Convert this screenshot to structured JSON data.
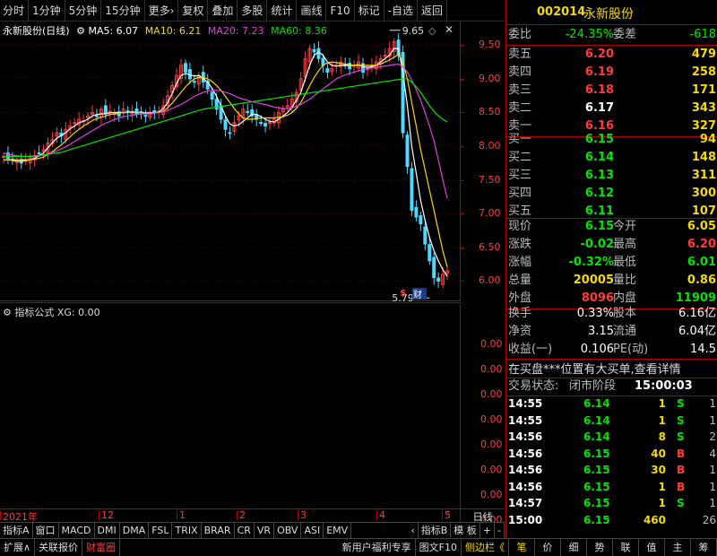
{
  "toolbar": {
    "tabs": [
      "分时",
      "1分钟",
      "5分钟",
      "15分钟",
      "更多›",
      "复权",
      "叠加",
      "多股",
      "统计",
      "画线",
      "F10",
      "标记",
      "-自选",
      "返回"
    ]
  },
  "chart": {
    "stock_name": "永新股份(日线)",
    "ma5": "MA5: 6.07",
    "ma10": "MA10: 6.21",
    "ma20": "MA20: 7.23",
    "ma60": "MA60: 8.36",
    "high_label": "9.65",
    "low_label": "5.79",
    "price_ticks": [
      "9.50",
      "9.00",
      "8.50",
      "8.00",
      "7.50",
      "7.00",
      "6.50",
      "6.00"
    ],
    "sub_title": "指标公式",
    "sub_value": "XG: 0.00",
    "sub_ticks": [
      "0.00",
      "0.00",
      "0.00",
      "0.00",
      "0.00",
      "0.00",
      "0.00",
      "0.00"
    ],
    "time_labels": [
      "2021年",
      "12",
      "1",
      "2",
      "3",
      "4",
      "5"
    ],
    "day_btn": "日线",
    "marker_s": "$",
    "marker_cai": "财",
    "colors": {
      "ma5": "#ffffff",
      "ma10": "#f5d90a",
      "ma20": "#e040e0",
      "ma60": "#00e600",
      "up": "#ff3b3b",
      "down": "#4fd8ff"
    }
  },
  "chart_data": {
    "type": "line",
    "title": "永新股份(日线)",
    "xlabel": "",
    "ylabel": "",
    "ylim": [
      5.7,
      9.85
    ],
    "x": [
      1,
      2,
      3,
      4,
      5,
      6,
      7,
      8,
      9,
      10,
      11,
      12,
      13,
      14,
      15,
      16,
      17,
      18,
      19,
      20,
      21,
      22,
      23,
      24,
      25,
      26,
      27,
      28,
      29,
      30,
      31,
      32,
      33,
      34,
      35,
      36,
      37,
      38,
      39,
      40,
      41,
      42,
      43,
      44,
      45,
      46,
      47,
      48,
      49,
      50,
      51,
      52,
      53,
      54,
      55,
      56,
      57,
      58,
      59,
      60,
      61,
      62,
      63,
      64,
      65,
      66,
      67,
      68,
      69,
      70,
      71,
      72,
      73,
      74,
      75,
      76,
      77,
      78,
      79,
      80,
      81,
      82,
      83,
      84,
      85,
      86,
      87,
      88,
      89,
      90,
      91,
      92,
      93,
      94,
      95,
      96,
      97,
      98,
      99,
      100,
      101,
      102,
      103,
      104,
      105,
      106,
      107,
      108,
      109,
      110,
      111,
      112,
      113,
      114,
      115,
      116,
      117,
      118,
      119,
      120
    ],
    "candles_close": [
      7.85,
      7.82,
      7.8,
      7.78,
      7.75,
      7.79,
      7.83,
      7.86,
      7.9,
      7.95,
      8.05,
      8.1,
      8.2,
      8.15,
      8.25,
      8.3,
      8.35,
      8.4,
      8.38,
      8.45,
      8.5,
      8.45,
      8.55,
      8.48,
      8.52,
      8.5,
      8.45,
      8.55,
      8.5,
      8.52,
      8.48,
      8.5,
      8.45,
      8.48,
      8.5,
      8.52,
      8.6,
      8.75,
      8.9,
      9.05,
      9.2,
      9.1,
      9.0,
      8.95,
      9.05,
      8.95,
      8.85,
      8.7,
      8.55,
      8.4,
      8.25,
      8.2,
      8.35,
      8.45,
      8.55,
      8.5,
      8.45,
      8.4,
      8.35,
      8.3,
      8.35,
      8.4,
      8.5,
      8.55,
      8.6,
      8.7,
      8.8,
      9.0,
      9.3,
      9.45,
      9.4,
      9.3,
      9.2,
      9.1,
      9.15,
      9.2,
      9.25,
      9.2,
      9.15,
      9.2,
      9.25,
      9.1,
      9.15,
      9.2,
      9.25,
      9.3,
      9.35,
      9.45,
      9.55,
      9.35,
      8.2,
      7.7,
      7.05,
      6.95,
      6.85,
      6.55,
      6.3,
      6.05,
      6.0,
      6.1,
      6.15
    ],
    "series": [
      {
        "name": "MA5",
        "values": [
          7.8,
          7.8,
          7.79,
          7.78,
          7.78,
          7.79,
          7.8,
          7.82,
          7.86,
          7.9,
          7.98,
          8.05,
          8.12,
          8.16,
          8.2,
          8.26,
          8.3,
          8.35,
          8.37,
          8.4,
          8.45,
          8.47,
          8.48,
          8.48,
          8.5,
          8.5,
          8.5,
          8.5,
          8.5,
          8.51,
          8.5,
          8.5,
          8.49,
          8.48,
          8.49,
          8.51,
          8.56,
          8.65,
          8.78,
          8.93,
          9.05,
          9.08,
          9.06,
          9.04,
          9.05,
          9.0,
          8.95,
          8.86,
          8.74,
          8.6,
          8.45,
          8.33,
          8.3,
          8.32,
          8.37,
          8.42,
          8.48,
          8.47,
          8.44,
          8.4,
          8.37,
          8.36,
          8.4,
          8.45,
          8.5,
          8.58,
          8.68,
          8.8,
          9.0,
          9.2,
          9.35,
          9.4,
          9.35,
          9.25,
          9.2,
          9.19,
          9.2,
          9.2,
          9.2,
          9.2,
          9.21,
          9.18,
          9.17,
          9.18,
          9.2,
          9.25,
          9.3,
          9.35,
          9.45,
          9.45,
          9.1,
          8.6,
          8.0,
          7.6,
          7.2,
          6.9,
          6.65,
          6.45,
          6.3,
          6.17,
          6.07
        ]
      },
      {
        "name": "MA10",
        "values": [
          7.8,
          7.8,
          7.8,
          7.8,
          7.8,
          7.8,
          7.8,
          7.81,
          7.82,
          7.84,
          7.88,
          7.92,
          7.97,
          8.02,
          8.08,
          8.14,
          8.2,
          8.25,
          8.3,
          8.34,
          8.38,
          8.41,
          8.43,
          8.45,
          8.47,
          8.48,
          8.49,
          8.5,
          8.5,
          8.5,
          8.5,
          8.5,
          8.5,
          8.5,
          8.5,
          8.5,
          8.52,
          8.57,
          8.64,
          8.72,
          8.8,
          8.88,
          8.95,
          9.0,
          9.02,
          9.02,
          9.0,
          8.96,
          8.9,
          8.83,
          8.74,
          8.65,
          8.56,
          8.48,
          8.42,
          8.4,
          8.4,
          8.41,
          8.42,
          8.42,
          8.42,
          8.42,
          8.43,
          8.44,
          8.46,
          8.5,
          8.56,
          8.65,
          8.77,
          8.9,
          9.02,
          9.12,
          9.2,
          9.24,
          9.25,
          9.24,
          9.23,
          9.22,
          9.21,
          9.2,
          9.2,
          9.2,
          9.2,
          9.2,
          9.2,
          9.22,
          9.25,
          9.28,
          9.32,
          9.36,
          9.25,
          9.0,
          8.65,
          8.3,
          7.95,
          7.65,
          7.35,
          7.05,
          6.75,
          6.45,
          6.21
        ]
      },
      {
        "name": "MA20",
        "values": [
          7.9,
          7.88,
          7.87,
          7.86,
          7.85,
          7.85,
          7.85,
          7.85,
          7.86,
          7.87,
          7.89,
          7.91,
          7.93,
          7.96,
          7.99,
          8.03,
          8.07,
          8.11,
          8.15,
          8.19,
          8.23,
          8.27,
          8.31,
          8.34,
          8.37,
          8.4,
          8.42,
          8.44,
          8.45,
          8.46,
          8.47,
          8.48,
          8.48,
          8.48,
          8.49,
          8.5,
          8.51,
          8.53,
          8.56,
          8.59,
          8.62,
          8.66,
          8.7,
          8.74,
          8.77,
          8.8,
          8.82,
          8.83,
          8.83,
          8.82,
          8.8,
          8.78,
          8.75,
          8.72,
          8.7,
          8.68,
          8.66,
          8.65,
          8.63,
          8.62,
          8.6,
          8.58,
          8.57,
          8.56,
          8.56,
          8.57,
          8.59,
          8.62,
          8.66,
          8.7,
          8.75,
          8.8,
          8.85,
          8.9,
          8.95,
          9.0,
          9.03,
          9.06,
          9.08,
          9.1,
          9.12,
          9.14,
          9.15,
          9.16,
          9.17,
          9.18,
          9.19,
          9.2,
          9.21,
          9.22,
          9.18,
          9.1,
          8.98,
          8.84,
          8.68,
          8.5,
          8.3,
          8.08,
          7.8,
          7.5,
          7.23
        ]
      },
      {
        "name": "MA60",
        "values": [
          7.85,
          7.85,
          7.85,
          7.85,
          7.85,
          7.85,
          7.85,
          7.86,
          7.86,
          7.87,
          7.88,
          7.89,
          7.9,
          7.91,
          7.93,
          7.95,
          7.97,
          7.99,
          8.01,
          8.03,
          8.05,
          8.07,
          8.09,
          8.11,
          8.13,
          8.15,
          8.17,
          8.19,
          8.21,
          8.23,
          8.25,
          8.27,
          8.29,
          8.31,
          8.33,
          8.35,
          8.37,
          8.39,
          8.41,
          8.43,
          8.45,
          8.47,
          8.49,
          8.51,
          8.53,
          8.55,
          8.56,
          8.57,
          8.58,
          8.59,
          8.6,
          8.61,
          8.62,
          8.63,
          8.64,
          8.65,
          8.66,
          8.67,
          8.68,
          8.69,
          8.7,
          8.71,
          8.72,
          8.73,
          8.74,
          8.75,
          8.76,
          8.77,
          8.78,
          8.79,
          8.8,
          8.81,
          8.82,
          8.83,
          8.84,
          8.85,
          8.86,
          8.87,
          8.88,
          8.89,
          8.9,
          8.91,
          8.92,
          8.93,
          8.94,
          8.95,
          8.96,
          8.97,
          8.98,
          8.99,
          9.0,
          9.0,
          8.95,
          8.88,
          8.8,
          8.7,
          8.6,
          8.52,
          8.45,
          8.4,
          8.36
        ]
      }
    ]
  },
  "quote": {
    "code": "002014",
    "name": "永新股份",
    "weibi_label": "委比",
    "weibi": "-24.35%",
    "weicha_label": "委差",
    "weicha": "-618",
    "sell": [
      {
        "label": "卖五",
        "price": "6.20",
        "vol": "479"
      },
      {
        "label": "卖四",
        "price": "6.19",
        "vol": "258"
      },
      {
        "label": "卖三",
        "price": "6.18",
        "vol": "171"
      },
      {
        "label": "卖二",
        "price": "6.17",
        "vol": "343"
      },
      {
        "label": "卖一",
        "price": "6.16",
        "vol": "327"
      }
    ],
    "buy": [
      {
        "label": "买一",
        "price": "6.15",
        "vol": "94"
      },
      {
        "label": "买二",
        "price": "6.14",
        "vol": "148"
      },
      {
        "label": "买三",
        "price": "6.13",
        "vol": "311"
      },
      {
        "label": "买四",
        "price": "6.12",
        "vol": "300"
      },
      {
        "label": "买五",
        "price": "6.11",
        "vol": "107"
      }
    ],
    "stats": [
      {
        "l1": "现价",
        "v1": "6.15",
        "l2": "今开",
        "v2": "6.05"
      },
      {
        "l1": "涨跌",
        "v1": "-0.02",
        "l2": "最高",
        "v2": "6.20"
      },
      {
        "l1": "涨幅",
        "v1": "-0.32%",
        "l2": "最低",
        "v2": "6.01"
      },
      {
        "l1": "总量",
        "v1": "20005",
        "l2": "量比",
        "v2": "0.86"
      },
      {
        "l1": "外盘",
        "v1": "8096",
        "l2": "内盘",
        "v2": "11909"
      }
    ],
    "stats2": [
      {
        "l1": "换手",
        "v1": "0.33%",
        "l2": "股本",
        "v2": "6.16亿"
      },
      {
        "l1": "净资",
        "v1": "3.15",
        "l2": "流通",
        "v2": "6.04亿"
      },
      {
        "l1": "收益(一)",
        "v1": "0.106",
        "l2": "PE(动)",
        "v2": "14.5"
      }
    ],
    "notice": "在买盘***位置有大买单,查看详情",
    "trade_status_label": "交易状态:",
    "trade_status": "闭市阶段",
    "trade_time": "15:00:03",
    "ticks": [
      {
        "t": "14:55",
        "p": "6.14",
        "v": "1",
        "d": "S",
        "n": "1"
      },
      {
        "t": "14:55",
        "p": "6.14",
        "v": "1",
        "d": "S",
        "n": "1"
      },
      {
        "t": "14:56",
        "p": "6.14",
        "v": "8",
        "d": "S",
        "n": "2"
      },
      {
        "t": "14:56",
        "p": "6.15",
        "v": "40",
        "d": "B",
        "n": "4"
      },
      {
        "t": "14:56",
        "p": "6.15",
        "v": "30",
        "d": "B",
        "n": "1"
      },
      {
        "t": "14:56",
        "p": "6.15",
        "v": "1",
        "d": "B",
        "n": "1"
      },
      {
        "t": "14:57",
        "p": "6.15",
        "v": "1",
        "d": "S",
        "n": "1"
      },
      {
        "t": "15:00",
        "p": "6.15",
        "v": "460",
        "d": "",
        "n": "26"
      }
    ]
  },
  "indicator_tabs": [
    "指标A",
    "窗口",
    "MACD",
    "DMI",
    "DMA",
    "FSL",
    "TRIX",
    "BRAR",
    "CR",
    "VR",
    "OBV",
    "ASI",
    "EMV",
    "‹",
    "指标B",
    "模 板",
    "+",
    "-"
  ],
  "bottom_bar": {
    "left": [
      "扩展∧",
      "关联报价",
      "财富圈"
    ],
    "middle": [
      "新用户福利专享",
      "图文F10",
      "侧边栏《"
    ],
    "right": [
      "笔",
      "价",
      "细",
      "势",
      "联",
      "值",
      "主",
      "筹"
    ]
  }
}
